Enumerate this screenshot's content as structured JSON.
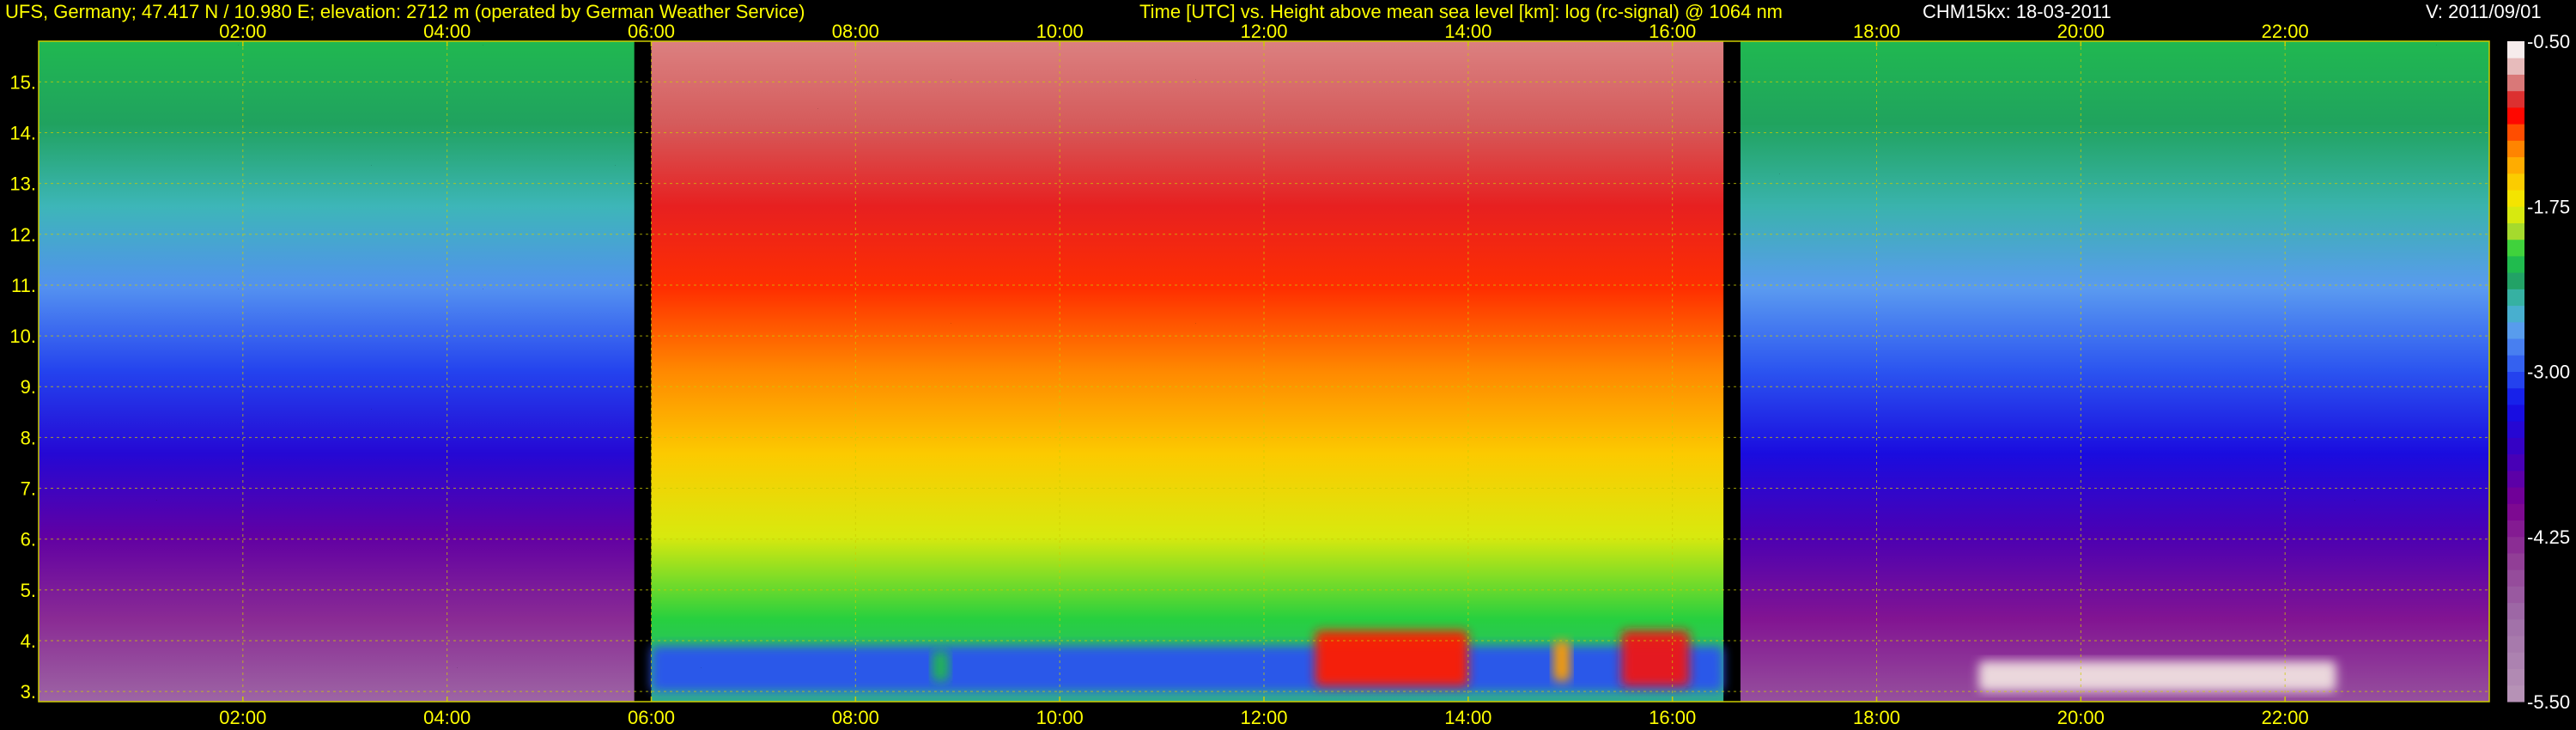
{
  "header": {
    "station": "UFS, Germany; 47.417 N / 10.980 E; elevation: 2712 m  (operated by German Weather Service)",
    "title": "Time [UTC] vs. Height above mean sea level [km]: log (rc-signal) @ 1064 nm",
    "instrument": "CHM15kx: 18-03-2011",
    "version": "V: 2011/09/01"
  },
  "colors": {
    "text_axis": "#ffff00",
    "text_header_white": "#ffffff",
    "grid": "#cccc00",
    "background": "#000000"
  },
  "chart_data": {
    "type": "heatmap",
    "title": "Time [UTC] vs. Height above mean sea level [km]: log (rc-signal) @ 1064 nm",
    "x_quantity": "Time [UTC]",
    "y_quantity": "Height above mean sea level [km]",
    "value_quantity": "log (rc-signal)",
    "xlim": [
      "00:00",
      "24:00"
    ],
    "ylim": [
      2.8,
      15.8
    ],
    "x_ticks": [
      "02:00",
      "04:00",
      "06:00",
      "08:00",
      "10:00",
      "12:00",
      "14:00",
      "16:00",
      "18:00",
      "20:00",
      "22:00"
    ],
    "y_ticks": [
      "3.",
      "4.",
      "5.",
      "6.",
      "7.",
      "8.",
      "9.",
      "10.",
      "11.",
      "12.",
      "13.",
      "14.",
      "15."
    ],
    "grid": true,
    "colorbar": {
      "range": [
        -5.5,
        -0.5
      ],
      "tick_labels": [
        "-0.50",
        "-1.75",
        "-3.00",
        "-4.25",
        "-5.50"
      ],
      "tick_values": [
        -0.5,
        -1.75,
        -3.0,
        -4.25,
        -5.5
      ],
      "colormap": [
        [
          -5.5,
          "#b896b8"
        ],
        [
          -4.9,
          "#a070a8"
        ],
        [
          -4.4,
          "#903a95"
        ],
        [
          -4.0,
          "#7a0090"
        ],
        [
          -3.6,
          "#3a00c0"
        ],
        [
          -3.25,
          "#1010e8"
        ],
        [
          -3.0,
          "#2a52f0"
        ],
        [
          -2.7,
          "#5a9af0"
        ],
        [
          -2.5,
          "#40b8c0"
        ],
        [
          -2.3,
          "#20a060"
        ],
        [
          -2.1,
          "#20d040"
        ],
        [
          -1.95,
          "#a0d830"
        ],
        [
          -1.75,
          "#f0f000"
        ],
        [
          -1.5,
          "#ffc000"
        ],
        [
          -1.25,
          "#ff7000"
        ],
        [
          -1.05,
          "#ff0000"
        ],
        [
          -0.9,
          "#d04040"
        ],
        [
          -0.75,
          "#e0a0a0"
        ],
        [
          -0.6,
          "#f0e0e0"
        ],
        [
          -0.5,
          "#ffffff"
        ]
      ]
    },
    "features": [
      {
        "label": "night background",
        "time": [
          "00:00",
          "05:50"
        ],
        "height_km": [
          2.8,
          15.8
        ],
        "log_signal_top": -2.2,
        "log_signal_bottom": -4.8
      },
      {
        "label": "daylight background",
        "time": [
          "06:00",
          "16:30"
        ],
        "height_km": [
          2.8,
          15.8
        ],
        "log_signal_top": -0.8,
        "log_signal_bottom": -2.4
      },
      {
        "label": "evening background",
        "time": [
          "16:40",
          "24:00"
        ],
        "height_km": [
          2.8,
          15.8
        ],
        "log_signal_top": -2.2,
        "log_signal_bottom": -4.6
      },
      {
        "label": "low aerosol layer",
        "time": [
          "06:00",
          "16:30"
        ],
        "height_km": [
          3.0,
          3.9
        ],
        "log_signal": -3.0
      },
      {
        "label": "cloud",
        "time": [
          "08:45",
          "08:55"
        ],
        "height_km": [
          3.2,
          3.8
        ],
        "log_signal": -2.2
      },
      {
        "label": "cloud",
        "time": [
          "12:30",
          "14:00"
        ],
        "height_km": [
          3.1,
          4.2
        ],
        "log_signal": -1.1
      },
      {
        "label": "cloud",
        "time": [
          "14:50",
          "15:00"
        ],
        "height_km": [
          3.2,
          4.0
        ],
        "log_signal": -1.4
      },
      {
        "label": "cloud",
        "time": [
          "15:30",
          "16:10"
        ],
        "height_km": [
          3.1,
          4.2
        ],
        "log_signal": -1.0
      },
      {
        "label": "cloud",
        "time": [
          "19:00",
          "22:30"
        ],
        "height_km": [
          3.0,
          3.6
        ],
        "log_signal": -0.6
      }
    ]
  }
}
